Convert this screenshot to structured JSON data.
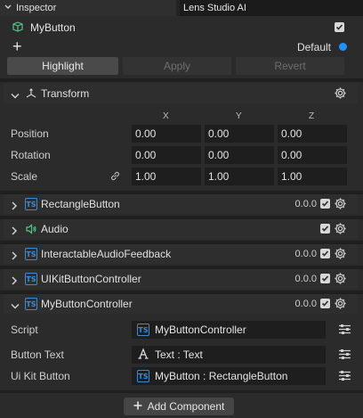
{
  "tabs": {
    "inspector": "Inspector",
    "ai": "Lens Studio AI"
  },
  "object": {
    "name": "MyButton",
    "enabled": true,
    "layer_label": "Default",
    "layer_color": "#1e90ff"
  },
  "prefab_buttons": {
    "highlight": "Highlight",
    "apply": "Apply",
    "revert": "Revert"
  },
  "transform": {
    "title": "Transform",
    "axes": [
      "X",
      "Y",
      "Z"
    ],
    "rows": [
      {
        "label": "Position",
        "values": [
          "0.00",
          "0.00",
          "0.00"
        ]
      },
      {
        "label": "Rotation",
        "values": [
          "0.00",
          "0.00",
          "0.00"
        ]
      },
      {
        "label": "Scale",
        "values": [
          "1.00",
          "1.00",
          "1.00"
        ]
      }
    ]
  },
  "components": [
    {
      "name": "RectangleButton",
      "version": "0.0.0",
      "icon": "ts-icon",
      "expanded": false
    },
    {
      "name": "Audio",
      "version": "",
      "icon": "speaker-icon",
      "expanded": false
    },
    {
      "name": "InteractableAudioFeedback",
      "version": "0.0.0",
      "icon": "ts-icon",
      "expanded": false
    },
    {
      "name": "UIKitButtonController",
      "version": "0.0.0",
      "icon": "ts-icon",
      "expanded": false
    },
    {
      "name": "MyButtonController",
      "version": "0.0.0",
      "icon": "ts-icon",
      "expanded": true
    }
  ],
  "controller_fields": [
    {
      "label": "Script",
      "value": "MyButtonController",
      "icon": "ts-icon"
    },
    {
      "label": "Button Text",
      "value": "Text : Text",
      "icon": "text-icon"
    },
    {
      "label": "Ui Kit Button",
      "value": "MyButton : RectangleButton",
      "icon": "ts-icon"
    }
  ],
  "add_component_label": "Add Component",
  "ts_icon_text": "TS",
  "colors": {
    "accent": "#3a8ad6",
    "background": "#2b2b2b",
    "field": "#1e1e1e"
  }
}
